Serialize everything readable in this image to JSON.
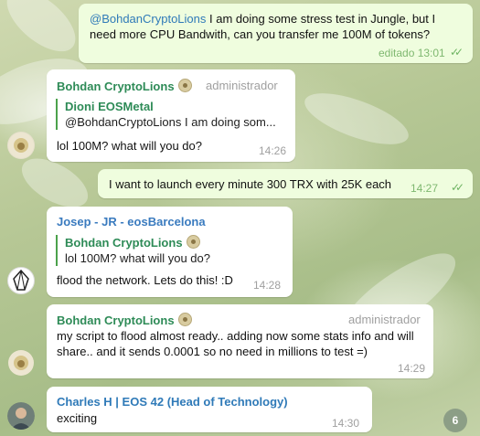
{
  "messages": {
    "m1": {
      "mention": "@BohdanCryptoLions",
      "text": " I am doing some stress test in Jungle, but I need more CPU Bandwith, can you transfer me 100M of tokens?",
      "time": "editado 13:01"
    },
    "m2": {
      "sender": "Bohdan CryptoLions",
      "role": "administrador",
      "reply_name": "Dioni EOSMetal",
      "reply_text": "@BohdanCryptoLions I am doing som...",
      "text": "lol 100M? what will you do?",
      "time": "14:26"
    },
    "m3": {
      "text": "I want to launch every minute 300 TRX with 25K each",
      "time": "14:27"
    },
    "m4": {
      "sender": "Josep - JR - eosBarcelona",
      "reply_name": "Bohdan CryptoLions",
      "reply_text": "lol 100M? what will you do?",
      "text": "flood the network. Lets do this! :D",
      "time": "14:28"
    },
    "m5": {
      "sender": "Bohdan CryptoLions",
      "role": "administrador",
      "text": "my script to flood almost ready.. adding now some stats info and will share.. and it sends 0.0001 so no need  in millions to test =)",
      "time": "14:29"
    },
    "m6": {
      "sender": "Charles H | EOS 42 (Head of Technology)",
      "text": "exciting",
      "time": "14:30"
    }
  },
  "unread_badge": "6",
  "colors": {
    "outgoing_bubble": "#effdde",
    "incoming_bubble": "#ffffff",
    "sender_green": "#2e8b57",
    "mention_blue": "#2f7ab8",
    "check_green": "#6fb463"
  },
  "icons": [
    "double-check-icon",
    "eos-logo-avatar",
    "lion-avatar-icon",
    "user-photo-avatar"
  ]
}
